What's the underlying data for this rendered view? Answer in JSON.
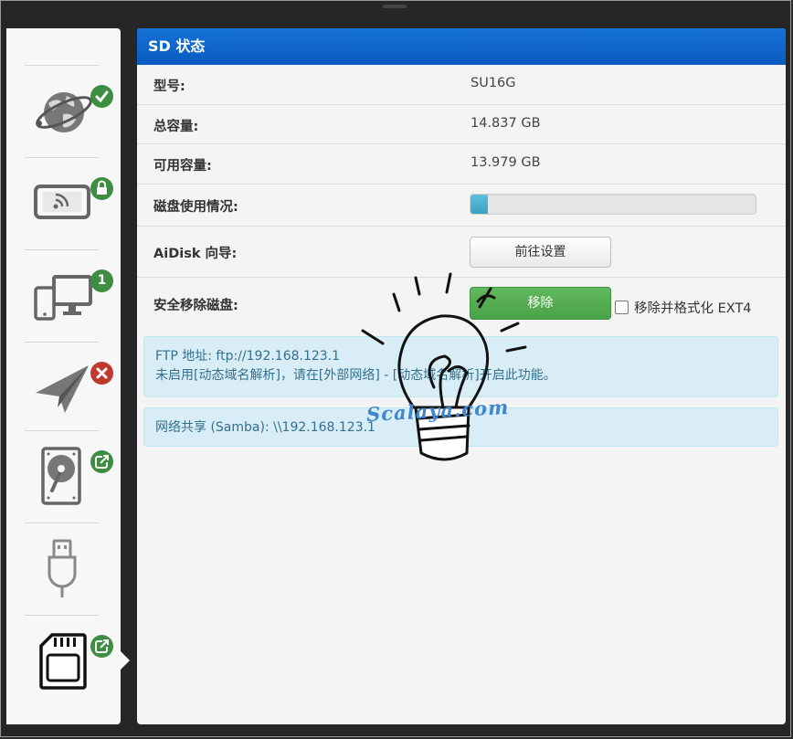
{
  "panel": {
    "title": "SD 状态"
  },
  "details": {
    "model_label": "型号:",
    "model_value": "SU16G",
    "capacity_label": "总容量:",
    "capacity_value": "14.837 GB",
    "available_label": "可用容量:",
    "available_value": "13.979 GB",
    "usage_label": "磁盘使用情况:",
    "usage_fraction": 0.06,
    "aidisk_label": "AiDisk 向导:",
    "aidisk_button": "前往设置",
    "eject_label": "安全移除磁盘:",
    "eject_button": "移除",
    "format_checkbox_label": "移除并格式化 EXT4",
    "format_checked": false
  },
  "ftp_info": {
    "line1": "FTP 地址: ftp://192.168.123.1",
    "line2": "未启用[动态域名解析]，请在[外部网络] - [动态域名解析]开启此功能。"
  },
  "samba_info": {
    "line1": "网络共享 (Samba): \\\\192.168.123.1"
  },
  "sidebar": {
    "items": [
      {
        "icon": "globe-internet-icon",
        "badge": "check-icon",
        "badge_color": "#3e8e41"
      },
      {
        "icon": "wifi-device-icon",
        "badge": "lock-icon",
        "badge_color": "#3e8e41"
      },
      {
        "icon": "clients-devices-icon",
        "badge": "1",
        "badge_color": "#3e8e41"
      },
      {
        "icon": "paper-plane-icon",
        "badge": "close-icon",
        "badge_color": "#c0392b"
      },
      {
        "icon": "hard-drive-icon",
        "badge": "eject-icon",
        "badge_color": "#3e8e41"
      },
      {
        "icon": "usb-icon",
        "badge": "",
        "badge_color": ""
      },
      {
        "icon": "sd-card-icon",
        "badge": "eject-icon",
        "badge_color": "#3e8e41"
      }
    ]
  },
  "watermark": {
    "text": "Scalaya.com"
  }
}
